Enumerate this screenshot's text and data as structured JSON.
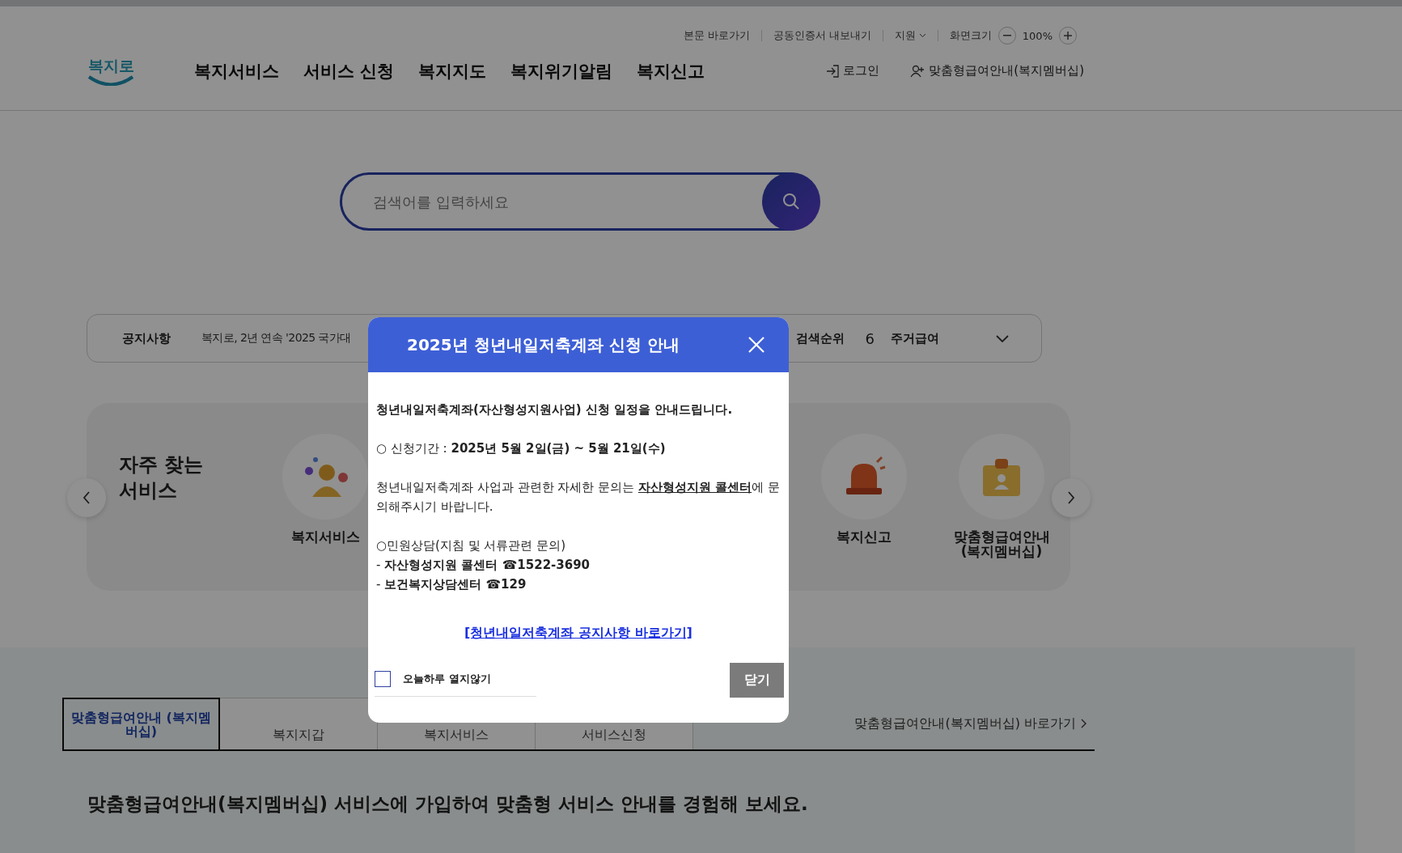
{
  "header": {
    "utility_links": [
      {
        "label": "본문 바로가기",
        "kind": "link"
      },
      {
        "label": "공동인증서 내보내기",
        "kind": "link"
      },
      {
        "label": "지원",
        "kind": "dropdown"
      }
    ],
    "zoom": {
      "label": "화면크기",
      "value": "100%"
    },
    "logo": "복지로",
    "nav": [
      "복지서비스",
      "서비스 신청",
      "복지지도",
      "복지위기알림",
      "복지신고"
    ],
    "account": [
      {
        "label": "로그인",
        "kind": "login"
      },
      {
        "label": "맞춤형급여안내(복지멤버십)",
        "kind": "member"
      }
    ]
  },
  "search": {
    "placeholder": "검색어를 입력하세요"
  },
  "notice_bar": {
    "label": "공지사항",
    "text": "복지로, 2년 연속 '2025 국가대",
    "ranking_label": "검색순위",
    "rank": "6",
    "term": "주거급여"
  },
  "frequent": {
    "title": "자주 찾는 서비스",
    "items": [
      {
        "label": "복지서비스",
        "kind": "person"
      },
      {
        "label": "복지신고",
        "kind": "siren"
      },
      {
        "label": "맞춤형급여안내 (복지멤버십)",
        "kind": "badge"
      }
    ]
  },
  "tabs": [
    {
      "label": "맞춤형급여안내 (복지멤버십)",
      "selected": true
    },
    {
      "label": "복지지갑",
      "selected": false
    },
    {
      "label": "복지서비스",
      "selected": false
    },
    {
      "label": "서비스신청",
      "selected": false
    }
  ],
  "tabs_link": "맞춤형급여안내(복지멤버십) 바로가기",
  "headline": "맞춤형급여안내(복지멤버십) 서비스에 가입하여 맞춤형 서비스 안내를 경험해 보세요.",
  "modal": {
    "title": "2025년 청년내일저축계좌 신청 안내",
    "paragraphs": [
      {
        "kind": "lead",
        "lines": [
          "청년내일저축계좌(자산형성지원사업) 신청 일정을 안내드립니다."
        ]
      },
      {
        "kind": "plain",
        "lines": [
          "○ 신청기간 : **2025년 5월 2일(금) ~ 5월 21일(수)**"
        ]
      },
      {
        "kind": "underline",
        "lines": [
          "청년내일저축계좌 사업과 관련한 자세한 문의는 **자산형성지원 콜센터**에 문의해주시기 바랍니다."
        ]
      },
      {
        "kind": "plain",
        "lines": [
          "○민원상담(지침 및 서류관련 문의)",
          " - **자산형성지원 콜센터 ☎1522-3690**",
          " - **보건복지상담센터 ☎129**"
        ]
      }
    ],
    "link": "[청년내일저축계좌 공지사항 바로가기]",
    "dont_show": {
      "label": "오늘하루 열지않기",
      "checked": false
    },
    "close_button": "닫기"
  }
}
